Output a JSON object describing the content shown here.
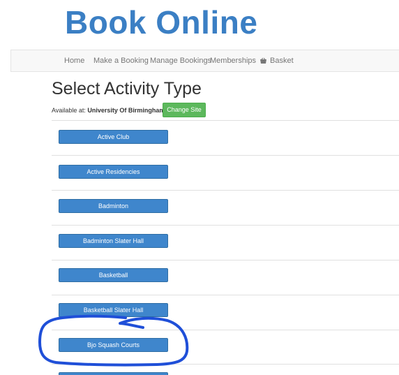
{
  "header": {
    "title": "Book Online"
  },
  "nav": {
    "items": [
      {
        "label": "Home"
      },
      {
        "label": "Make a Booking"
      },
      {
        "label": "Manage Bookings"
      },
      {
        "label": "Memberships"
      },
      {
        "label": "Basket",
        "icon": "basket-icon"
      }
    ]
  },
  "main": {
    "heading": "Select Activity Type",
    "available_label": "Available at:",
    "site_name": "University Of Birmingham",
    "change_site_label": "Change Site",
    "activities": [
      {
        "label": "Active Club"
      },
      {
        "label": "Active Residencies"
      },
      {
        "label": "Badminton"
      },
      {
        "label": "Badminton Slater Hall"
      },
      {
        "label": "Basketball"
      },
      {
        "label": "Basketball Slater Hall"
      },
      {
        "label": "Bjo Squash Courts"
      },
      {
        "label": ""
      }
    ]
  },
  "colors": {
    "title": "#3b7fc4",
    "primary_button": "#3f86cc",
    "success_button": "#5cb85c",
    "annotation": "#1f4fd8"
  }
}
